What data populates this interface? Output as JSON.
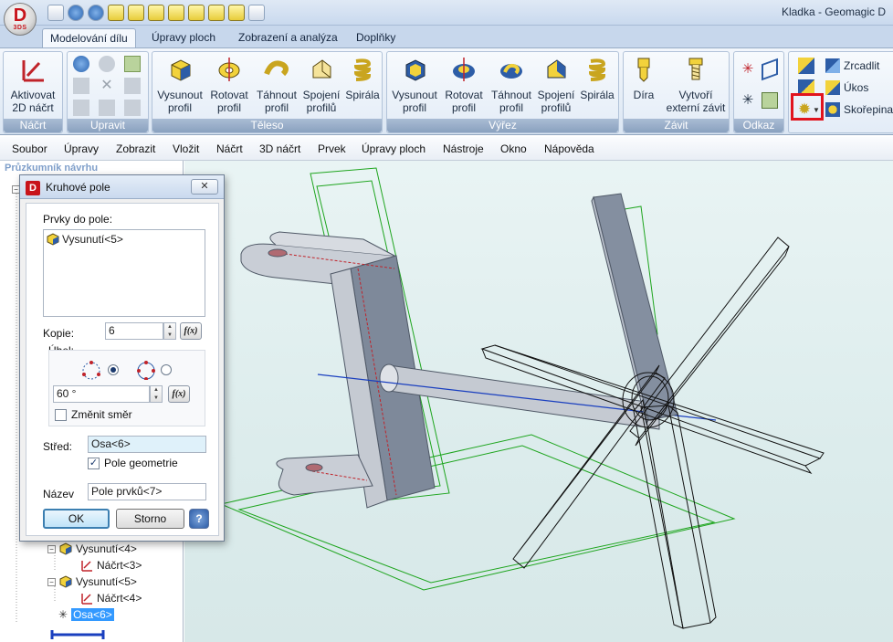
{
  "window": {
    "title": "Kladka - Geomagic D"
  },
  "app_logo": {
    "letter": "D",
    "sub": "3DS"
  },
  "ribbon_tabs": [
    {
      "label": "Modelování dílu",
      "active": true
    },
    {
      "label": "Úpravy ploch"
    },
    {
      "label": "Zobrazení a analýza"
    },
    {
      "label": "Doplňky"
    }
  ],
  "ribbon": {
    "sketch_group": {
      "title": "Náčrt",
      "activate_label": "Aktivovat\n2D náčrt"
    },
    "edit_group": {
      "title": "Upravit"
    },
    "solid_group": {
      "title": "Těleso",
      "buttons": [
        "Vysunout profil",
        "Rotovat profil",
        "Táhnout profil",
        "Spojení profilů",
        "Spirála"
      ]
    },
    "cut_group": {
      "title": "Výřez",
      "buttons": [
        "Vysunout profil",
        "Rotovat profil",
        "Táhnout profil",
        "Spojení profilů",
        "Spirála"
      ]
    },
    "thread_group": {
      "title": "Závit",
      "buttons": [
        "Díra",
        "Vytvoří externí závit"
      ]
    },
    "reference_group": {
      "title": "Odkaz"
    },
    "features": {
      "mirror": "Zrcadlit",
      "draft": "Úkos",
      "shell": "Skořepina"
    }
  },
  "menu": [
    "Soubor",
    "Úpravy",
    "Zobrazit",
    "Vložit",
    "Náčrt",
    "3D náčrt",
    "Prvek",
    "Úpravy ploch",
    "Nástroje",
    "Okno",
    "Nápověda"
  ],
  "left_panel": {
    "title": "Průzkumník návrhu",
    "tree": [
      {
        "label": "Vysunutí<4>",
        "type": "extrude"
      },
      {
        "label": "Náčrt<3>",
        "type": "sketch"
      },
      {
        "label": "Vysunutí<5>",
        "type": "extrude"
      },
      {
        "label": "Náčrt<4>",
        "type": "sketch"
      },
      {
        "label": "Osa<6>",
        "type": "axis",
        "selected": true
      }
    ]
  },
  "dialog": {
    "title": "Kruhové pole",
    "close_label": "✕",
    "features_label": "Prvky do pole:",
    "features": [
      "Vysunutí<5>"
    ],
    "copies_label": "Kopie:",
    "copies_value": "6",
    "angle_label": "Úhel:",
    "angle_value": "60 °",
    "reverse_label": "Změnit směr",
    "reverse_checked": false,
    "center_label": "Střed:",
    "center_value": "Osa<6>",
    "geometry_pattern_label": "Pole geometrie",
    "geometry_pattern_checked": true,
    "name_label": "Název",
    "name_value": "Pole prvků<7>",
    "ok_label": "OK",
    "cancel_label": "Storno",
    "help_label": "?",
    "fx_label": "f(x)"
  },
  "colors": {
    "ribbon_accent": "#8aa1bf",
    "selection": "#3399ff",
    "highlight_box": "#e1141e",
    "viewport_bg": "#dcecec",
    "model_face": "#8a95a5",
    "sketch_green": "#1ea51e"
  }
}
